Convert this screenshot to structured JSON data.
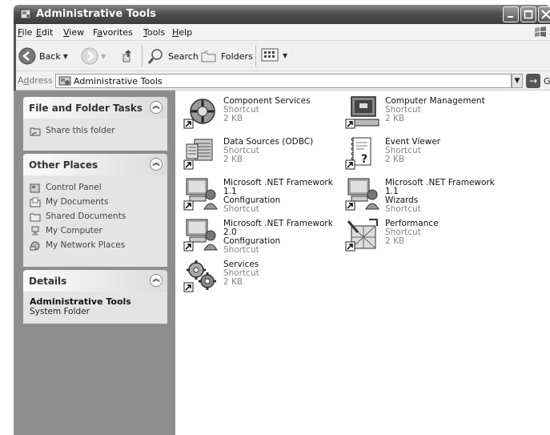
{
  "window": {
    "title": "Administrative Tools"
  },
  "menu": {
    "items": [
      {
        "key": "F",
        "rest": "ile"
      },
      {
        "key": "E",
        "rest": "dit"
      },
      {
        "key": "V",
        "rest": "iew"
      },
      {
        "key": "a",
        "pre": "F",
        "rest": "vorites"
      },
      {
        "key": "T",
        "rest": "ools"
      },
      {
        "key": "H",
        "rest": "elp"
      }
    ]
  },
  "toolbar": {
    "back_label": "Back",
    "search_label": "Search",
    "folders_label": "Folders"
  },
  "address": {
    "label_key": "d",
    "label_pre": "A",
    "label_rest": "dress",
    "value": "Administrative Tools",
    "go_label": "Go"
  },
  "taskpane": {
    "file_tasks": {
      "title": "File and Folder Tasks",
      "items": [
        "Share this folder"
      ]
    },
    "other_places": {
      "title": "Other Places",
      "items": [
        "Control Panel",
        "My Documents",
        "Shared Documents",
        "My Computer",
        "My Network Places"
      ]
    },
    "details": {
      "title": "Details",
      "name": "Administrative Tools",
      "type": "System Folder"
    }
  },
  "files": [
    {
      "name": "Component Services",
      "line2": "Shortcut",
      "line3": "2 KB",
      "icon": "component-services-icon"
    },
    {
      "name": "Computer Management",
      "line2": "Shortcut",
      "line3": "2 KB",
      "icon": "computer-management-icon"
    },
    {
      "name": "Data Sources (ODBC)",
      "line2": "Shortcut",
      "line3": "2 KB",
      "icon": "data-sources-icon"
    },
    {
      "name": "Event Viewer",
      "line2": "Shortcut",
      "line3": "2 KB",
      "icon": "event-viewer-icon"
    },
    {
      "name": "Microsoft .NET Framework 1.1",
      "line2": "Configuration",
      "line3": "Shortcut",
      "icon": "dotnet-config-icon"
    },
    {
      "name": "Microsoft .NET Framework 1.1",
      "line2": "Wizards",
      "line3": "Shortcut",
      "icon": "dotnet-wizards-icon"
    },
    {
      "name": "Microsoft .NET Framework 2.0",
      "line2": "Configuration",
      "line3": "Shortcut",
      "icon": "dotnet20-config-icon"
    },
    {
      "name": "Performance",
      "line2": "Shortcut",
      "line3": "2 KB",
      "icon": "performance-icon"
    },
    {
      "name": "Services",
      "line2": "Shortcut",
      "line3": "2 KB",
      "icon": "services-icon"
    }
  ]
}
